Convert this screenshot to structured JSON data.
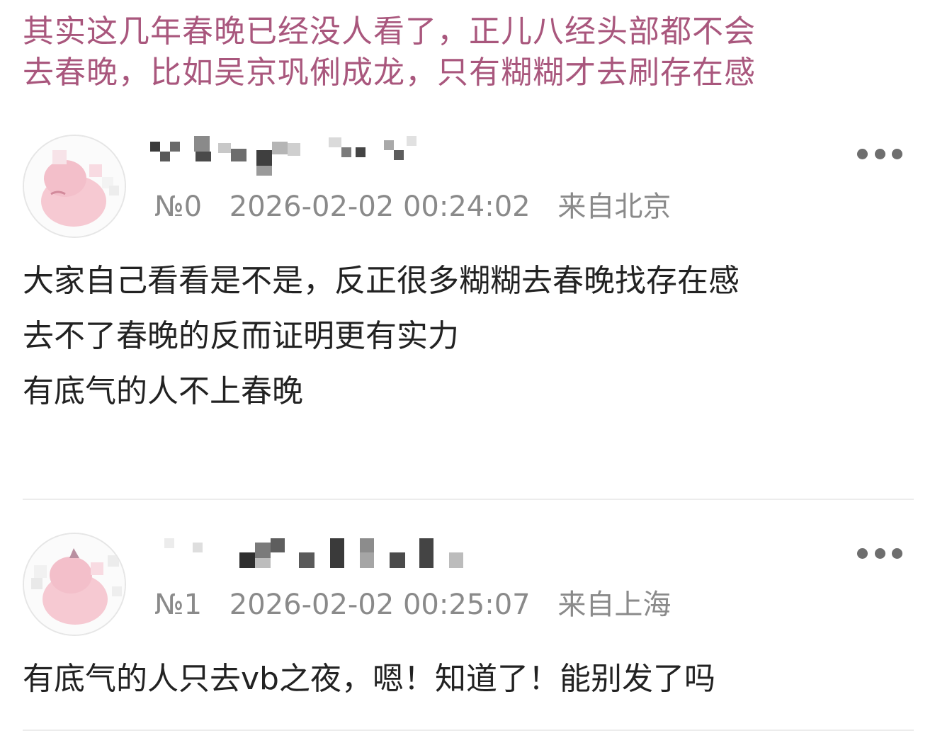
{
  "headline": {
    "lines": [
      "其实这几年春晚已经没人看了，正儿八经头部都不会",
      "去春晚，比如吴京巩俐成龙，只有糊糊才去刷存在感"
    ]
  },
  "replies": [
    {
      "floor": "№0",
      "datetime": "2026-02-02 00:24:02",
      "location": "来自北京",
      "more_icon": "more-horizontal-icon",
      "body_lines": [
        "大家自己看看是不是，反正很多糊糊去春晚找存在感",
        "去不了春晚的反而证明更有实力",
        "有底气的人不上春晚"
      ]
    },
    {
      "floor": "№1",
      "datetime": "2026-02-02 00:25:07",
      "location": "来自上海",
      "more_icon": "more-horizontal-icon",
      "body_lines": [
        "有底气的人只去vb之夜，嗯！知道了！能别发了吗"
      ]
    }
  ],
  "colors": {
    "headline": "#a9577d",
    "meta": "#8a8a8a",
    "body": "#222222",
    "divider": "#ececec",
    "avatar_pink": "#f6c9d2"
  }
}
